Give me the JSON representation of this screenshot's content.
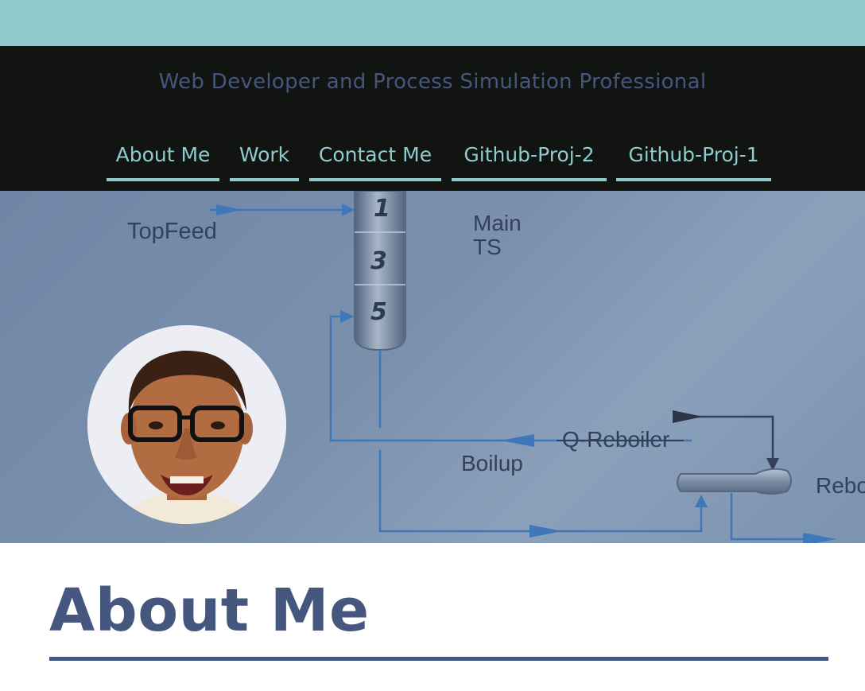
{
  "header": {
    "tagline": "Web Developer and Process Simulation Professional",
    "nav": [
      {
        "label": "About Me"
      },
      {
        "label": "Work"
      },
      {
        "label": "Contact Me"
      },
      {
        "label": "Github-Proj-2"
      },
      {
        "label": "Github-Proj-1"
      }
    ]
  },
  "hero": {
    "diagram_labels": {
      "top_feed": "TopFeed",
      "main": "Main",
      "ts": "TS",
      "tray_1": "1",
      "tray_3": "3",
      "tray_5": "5",
      "q_reboiler": "Q-Reboiler",
      "boilup": "Boilup",
      "reboiler_cut": "Rebo"
    }
  },
  "main": {
    "section_title": "About Me"
  },
  "colors": {
    "accent": "#8fcbcd",
    "header_bg": "#111411",
    "brand_blue": "#45577f"
  }
}
